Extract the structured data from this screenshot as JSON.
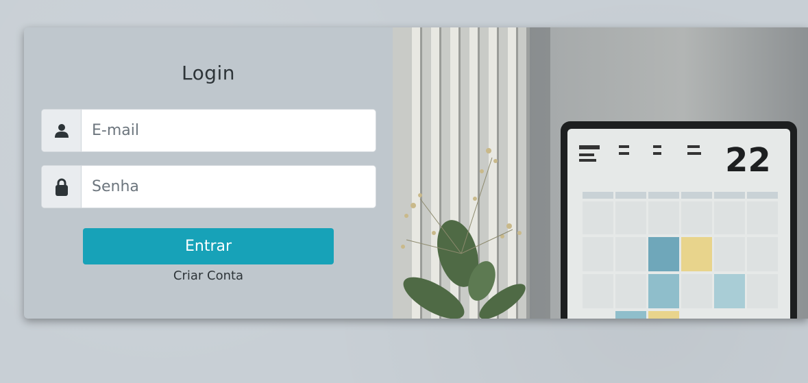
{
  "login": {
    "title": "Login",
    "email_placeholder": "E-mail",
    "password_placeholder": "Senha",
    "submit_label": "Entrar",
    "create_account_label": "Criar Conta"
  },
  "icons": {
    "email": "user-icon",
    "password": "lock-icon"
  },
  "colors": {
    "primary_button": "#17a2b8",
    "card_background": "#bfc7cd",
    "page_background": "#c8cfd5"
  },
  "photo": {
    "calendar_day": "22"
  }
}
